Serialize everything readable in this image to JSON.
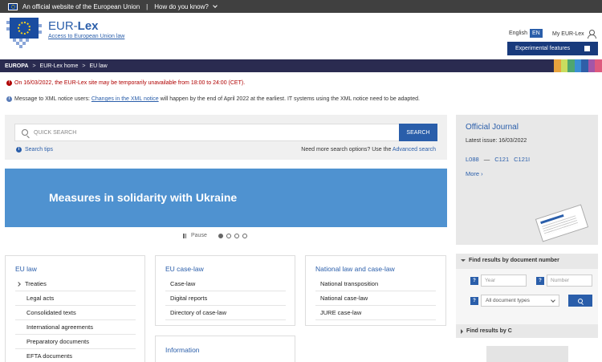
{
  "topbar": {
    "official_text": "An official website of the European Union",
    "separator": "|",
    "did_you_know": "How do you know?"
  },
  "header": {
    "brand_prefix": "EUR-",
    "brand_suffix": "Lex",
    "tagline": "Access to European Union law",
    "language": "English",
    "language_code": "EN",
    "my_eurlex": "My EUR-Lex",
    "experimental": "Experimental features"
  },
  "breadcrumb": {
    "items": [
      "EUROPA",
      "EUR-Lex home",
      "EU law"
    ],
    "sep": ">"
  },
  "colors": {
    "accent": "#2a5eaa",
    "banner": "#4f92d0",
    "navbar": "#2a2b50",
    "alert": "#b00000"
  },
  "notices": {
    "alert": "On 16/03/2022, the EUR-Lex site may be temporarily unavailable from 18:00 to 24:00 (CET).",
    "xml_prefix": "Message to XML notice users: ",
    "xml_link": "Changes in the XML notice",
    "xml_suffix": " will happen by the end of April 2022 at the earliest. IT systems using the XML notice need to be adapted."
  },
  "search": {
    "placeholder": "QUICK SEARCH",
    "button": "SEARCH",
    "tips": "Search tips",
    "more_prefix": "Need more search options? Use the ",
    "advanced_link": "Advanced search"
  },
  "banner": {
    "title": "Measures in solidarity with Ukraine",
    "pause": "Pause"
  },
  "eu_law": {
    "title": "EU law",
    "items": [
      "Treaties",
      "Legal acts",
      "Consolidated texts",
      "International agreements",
      "Preparatory documents",
      "EFTA documents"
    ]
  },
  "eu_case_law": {
    "title": "EU case-law",
    "items": [
      "Case-law",
      "Digital reports",
      "Directory of case-law"
    ]
  },
  "national": {
    "title": "National law and case-law",
    "items": [
      "National transposition",
      "National case-law",
      "JURE case-law"
    ]
  },
  "information": {
    "title": "Information"
  },
  "official_journal": {
    "title": "Official Journal",
    "latest_issue": "Latest issue: 16/03/2022",
    "link1": "L088",
    "dash": "—",
    "link2": "C121",
    "link3": "C121I",
    "more": "More ›"
  },
  "find_number": {
    "title": "Find results by document number",
    "q": "?",
    "year_placeholder": "Year",
    "number_placeholder": "Number",
    "doc_types": "All document types"
  },
  "find_class": {
    "title": "Find results by C"
  }
}
